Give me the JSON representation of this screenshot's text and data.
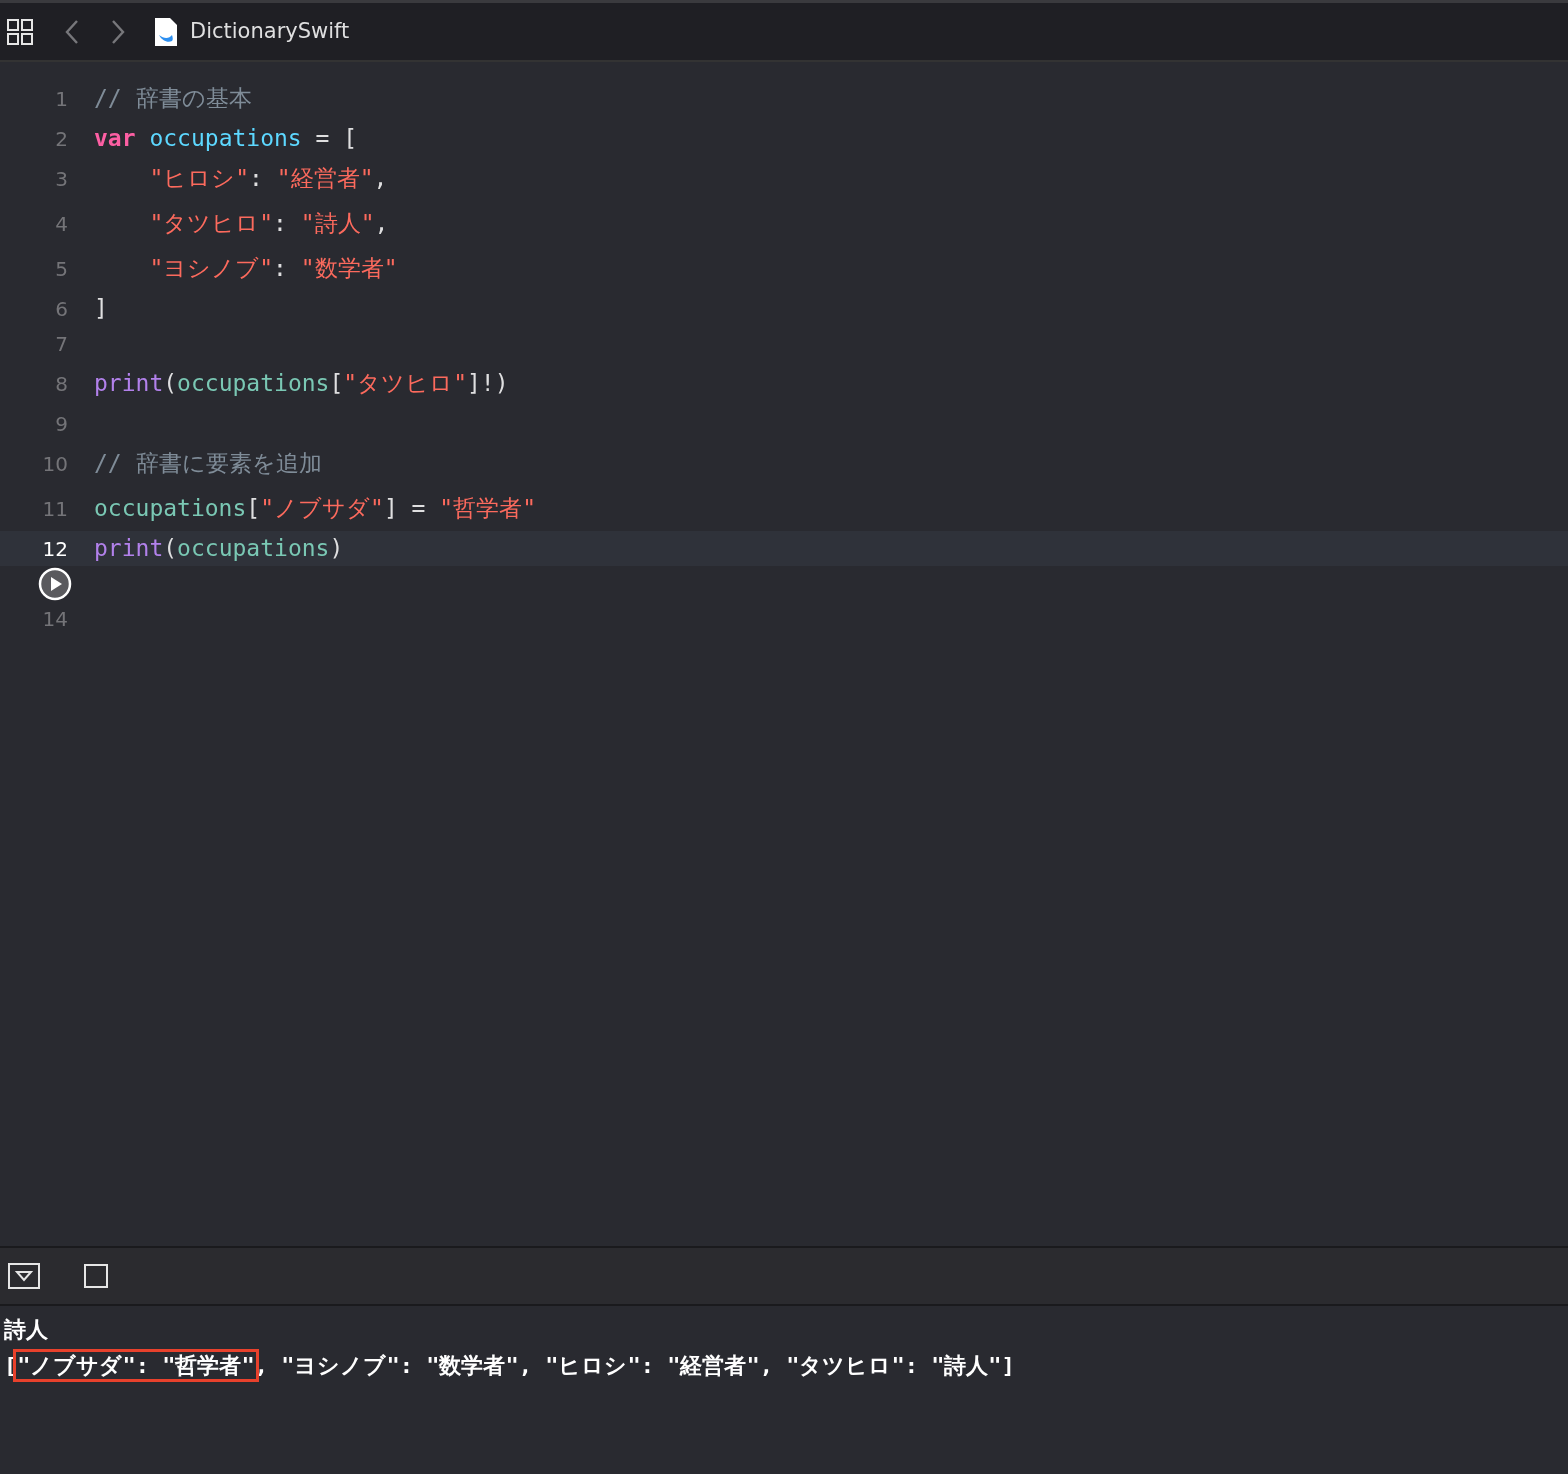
{
  "window": {
    "title": "DictionarySwift"
  },
  "editor": {
    "lines": [
      {
        "kind": "code",
        "number": "1",
        "current": false,
        "tokens": [
          {
            "kind": "comment",
            "text": "// 辞書の基本"
          }
        ]
      },
      {
        "kind": "code",
        "number": "2",
        "current": false,
        "tokens": [
          {
            "kind": "keyword",
            "text": "var "
          },
          {
            "kind": "declaration",
            "text": "occupations"
          },
          {
            "kind": "plain",
            "text": " = ["
          }
        ]
      },
      {
        "kind": "code",
        "number": "3",
        "current": false,
        "tokens": [
          {
            "kind": "string",
            "text": "    \"ヒロシ\""
          },
          {
            "kind": "plain",
            "text": ": "
          },
          {
            "kind": "string",
            "text": "\"経営者\""
          },
          {
            "kind": "plain",
            "text": ","
          }
        ]
      },
      {
        "kind": "code",
        "number": "4",
        "current": false,
        "tokens": [
          {
            "kind": "string",
            "text": "    \"タツヒロ\""
          },
          {
            "kind": "plain",
            "text": ": "
          },
          {
            "kind": "string",
            "text": "\"詩人\""
          },
          {
            "kind": "plain",
            "text": ","
          }
        ]
      },
      {
        "kind": "code",
        "number": "5",
        "current": false,
        "tokens": [
          {
            "kind": "string",
            "text": "    \"ヨシノブ\""
          },
          {
            "kind": "plain",
            "text": ": "
          },
          {
            "kind": "string",
            "text": "\"数学者\""
          }
        ]
      },
      {
        "kind": "code",
        "number": "6",
        "current": false,
        "tokens": [
          {
            "kind": "plain",
            "text": "]"
          }
        ]
      },
      {
        "kind": "code",
        "number": "7",
        "current": false
      },
      {
        "kind": "code",
        "number": "8",
        "current": false,
        "tokens": [
          {
            "kind": "function",
            "text": "print"
          },
          {
            "kind": "plain",
            "text": "("
          },
          {
            "kind": "variable",
            "text": "occupations"
          },
          {
            "kind": "plain",
            "text": "["
          },
          {
            "kind": "string",
            "text": "\"タツヒロ\""
          },
          {
            "kind": "plain",
            "text": "]!)"
          }
        ]
      },
      {
        "kind": "code",
        "number": "9",
        "current": false
      },
      {
        "kind": "code",
        "number": "10",
        "current": false,
        "tokens": [
          {
            "kind": "comment",
            "text": "// 辞書に要素を追加"
          }
        ]
      },
      {
        "kind": "code",
        "number": "11",
        "current": false,
        "tokens": [
          {
            "kind": "variable",
            "text": "occupations"
          },
          {
            "kind": "plain",
            "text": "["
          },
          {
            "kind": "string",
            "text": "\"ノブサダ\""
          },
          {
            "kind": "plain",
            "text": "] = "
          },
          {
            "kind": "string",
            "text": "\"哲学者\""
          }
        ]
      },
      {
        "kind": "code",
        "number": "12",
        "current": true,
        "tokens": [
          {
            "kind": "function",
            "text": "print"
          },
          {
            "kind": "plain",
            "text": "("
          },
          {
            "kind": "variable",
            "text": "occupations"
          },
          {
            "kind": "plain",
            "text": ")"
          }
        ]
      },
      {
        "kind": "run",
        "current": false
      },
      {
        "kind": "code",
        "number": "14",
        "current": false
      }
    ]
  },
  "console": {
    "lines": [
      [
        {
          "text": "詩人"
        }
      ],
      [
        {
          "text": "["
        },
        {
          "text": "\"ノブサダ\": \"哲学者\"",
          "highlighted": true
        },
        {
          "text": ", \"ヨシノブ\": \"数学者\", \"ヒロシ\": \"経営者\", \"タツヒロ\": \"詩人\"]"
        }
      ]
    ]
  }
}
